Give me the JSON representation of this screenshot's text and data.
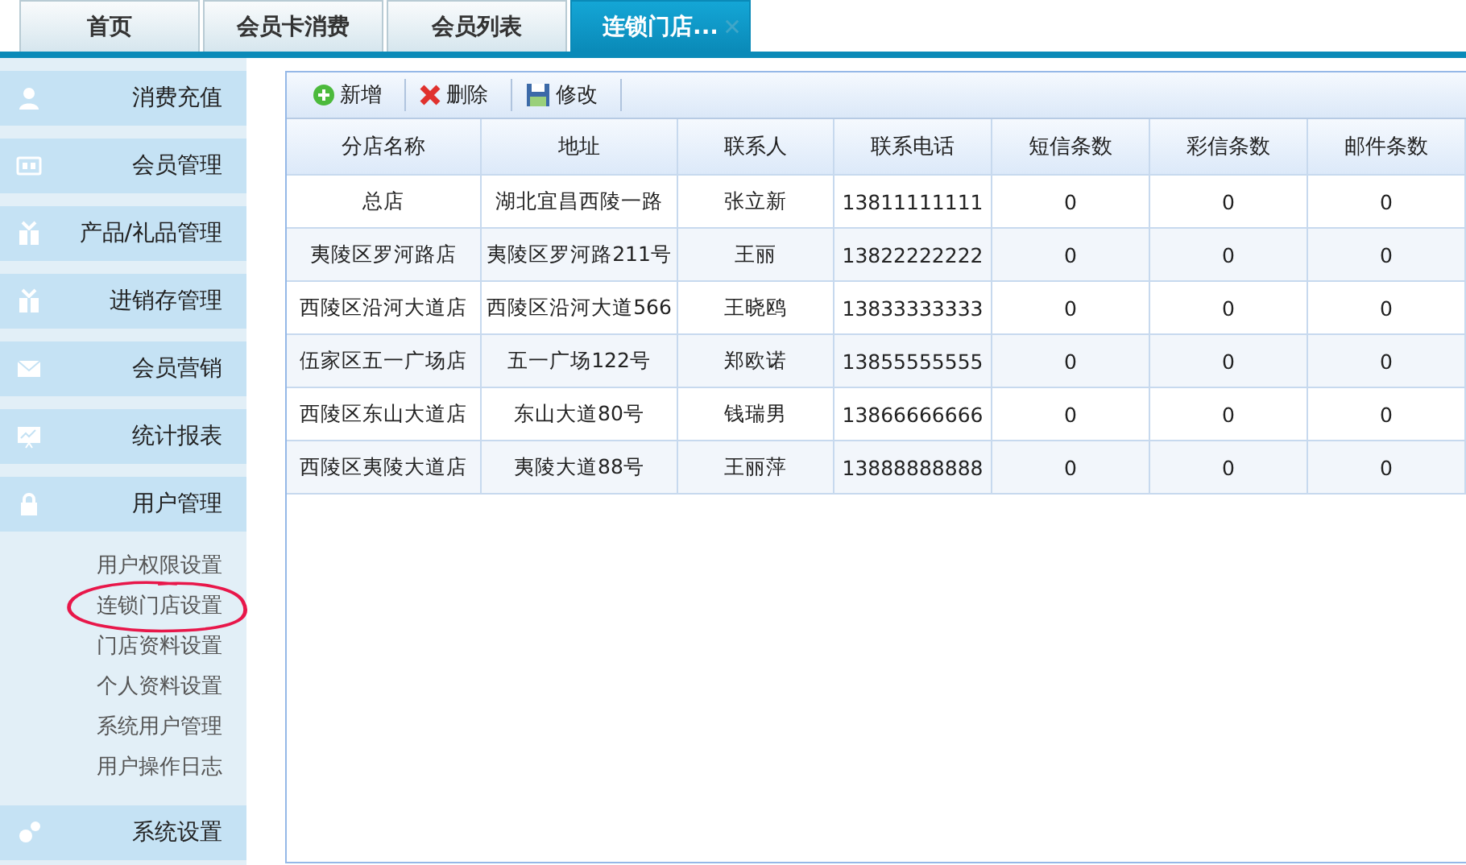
{
  "tabs": [
    {
      "label": "首页",
      "selected": false,
      "closable": false
    },
    {
      "label": "会员卡消费",
      "selected": false,
      "closable": false
    },
    {
      "label": "会员列表",
      "selected": false,
      "closable": false
    },
    {
      "label": "连锁门店...",
      "selected": true,
      "closable": true
    }
  ],
  "sidebar": {
    "items": [
      {
        "label": "消费充值"
      },
      {
        "label": "会员管理"
      },
      {
        "label": "产品/礼品管理"
      },
      {
        "label": "进销存管理"
      },
      {
        "label": "会员营销"
      },
      {
        "label": "统计报表"
      },
      {
        "label": "用户管理",
        "children": [
          {
            "label": "用户权限设置",
            "circled": false
          },
          {
            "label": "连锁门店设置",
            "circled": true
          },
          {
            "label": "门店资料设置",
            "circled": false
          },
          {
            "label": "个人资料设置",
            "circled": false
          },
          {
            "label": "系统用户管理",
            "circled": false
          },
          {
            "label": "用户操作日志",
            "circled": false
          }
        ]
      },
      {
        "label": "系统设置"
      }
    ]
  },
  "toolbar": [
    {
      "kind": "add",
      "label": "新增"
    },
    {
      "kind": "delete",
      "label": "删除"
    },
    {
      "kind": "save",
      "label": "修改"
    }
  ],
  "table": {
    "columns": [
      "分店名称",
      "地址",
      "联系人",
      "联系电话",
      "短信条数",
      "彩信条数",
      "邮件条数"
    ],
    "rows": [
      [
        "总店",
        "湖北宜昌西陵一路",
        "张立新",
        "13811111111",
        "0",
        "0",
        "0"
      ],
      [
        "夷陵区罗河路店",
        "夷陵区罗河路211号",
        "王丽",
        "13822222222",
        "0",
        "0",
        "0"
      ],
      [
        "西陵区沿河大道店",
        "西陵区沿河大道566",
        "王晓鸥",
        "13833333333",
        "0",
        "0",
        "0"
      ],
      [
        "伍家区五一广场店",
        "五一广场122号",
        "郑欧诺",
        "13855555555",
        "0",
        "0",
        "0"
      ],
      [
        "西陵区东山大道店",
        "东山大道80号",
        "钱瑞男",
        "13866666666",
        "0",
        "0",
        "0"
      ],
      [
        "西陵区夷陵大道店",
        "夷陵大道88号",
        "王丽萍",
        "13888888888",
        "0",
        "0",
        "0"
      ]
    ]
  }
}
